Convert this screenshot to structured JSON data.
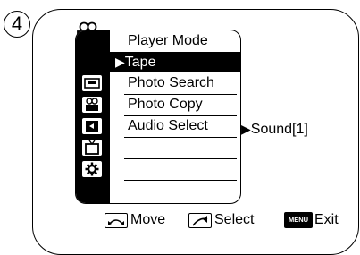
{
  "step": {
    "number": "4"
  },
  "menu": {
    "header": "Player Mode",
    "items": [
      {
        "label": "Tape",
        "selected": true,
        "arrow": "▶"
      },
      {
        "label": "Photo Search",
        "selected": false
      },
      {
        "label": "Photo Copy",
        "selected": false
      },
      {
        "label": "Audio Select",
        "selected": false
      }
    ],
    "sidebar_icons": [
      "camera-mode-icon",
      "tape-icon",
      "camera-icon",
      "memory-card-icon",
      "tv-icon",
      "gear-icon"
    ]
  },
  "submenu": {
    "arrow": "▶",
    "value": "Sound[1]"
  },
  "footer": {
    "move_label": "Move",
    "select_label": "Select",
    "menu_key_label": "MENU",
    "exit_label": "Exit"
  },
  "colors": {
    "background": "#ffffff",
    "foreground": "#000000",
    "highlight": "#000000"
  }
}
